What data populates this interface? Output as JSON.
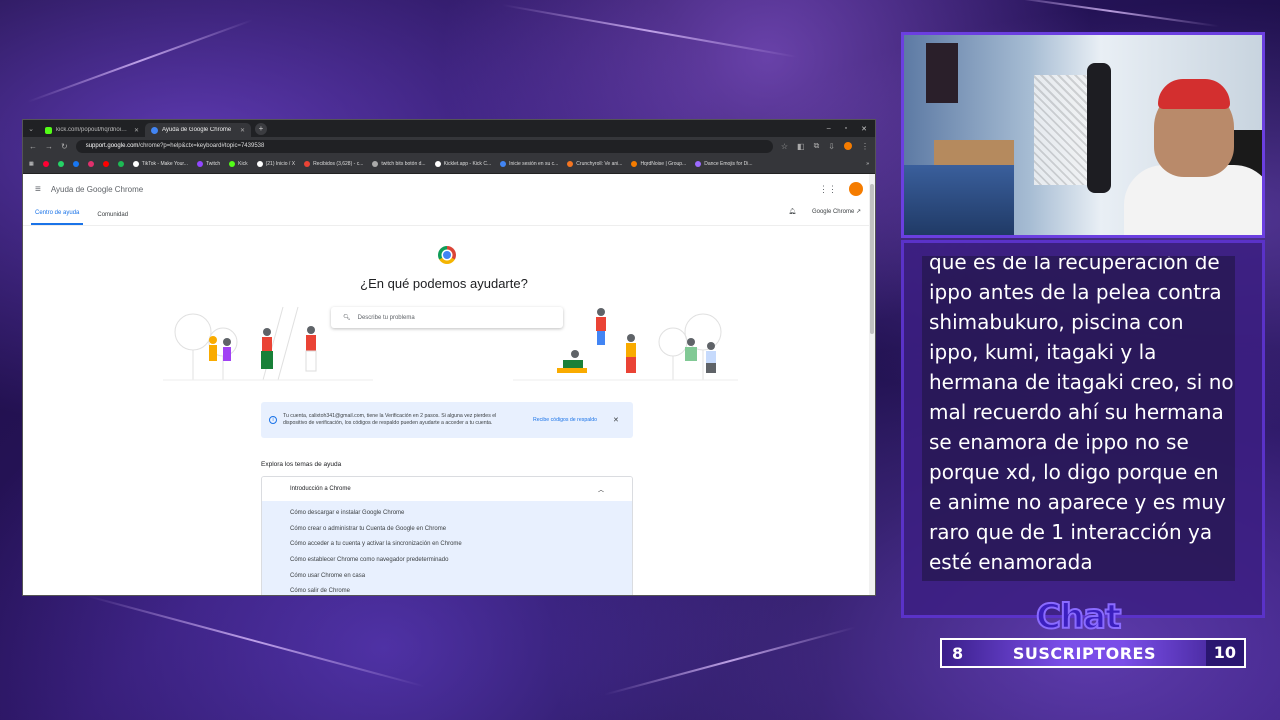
{
  "browser": {
    "tabs": [
      {
        "label": "kick.com/popout/hqrdnoise/ch",
        "favicon_color": "#53fc18",
        "active": false
      },
      {
        "label": "Ayuda de Google Chrome",
        "favicon_color": "#4285f4",
        "active": true
      }
    ],
    "url_host": "support.google.com",
    "url_path": "/chrome?p=help&ctx=keyboard#topic=7439538",
    "bookmarks": [
      {
        "label": "TikTok - Make Your...",
        "color": "#ffffff"
      },
      {
        "label": "Twitch",
        "color": "#9146ff"
      },
      {
        "label": "Kick",
        "color": "#53fc18"
      },
      {
        "label": "(21) Inicio / X",
        "color": "#ffffff"
      },
      {
        "label": "Recibidos (3,628) - c...",
        "color": "#ea4335"
      },
      {
        "label": "twitch bits botón d...",
        "color": "#aaaaaa"
      },
      {
        "label": "Kicklet.app - Kick C...",
        "color": "#ffffff"
      },
      {
        "label": "Inicie sesión en su c...",
        "color": "#4285f4"
      },
      {
        "label": "Crunchyroll: Ve ani...",
        "color": "#f47521"
      },
      {
        "label": "HqrdNoise | Group...",
        "color": "#f57c00"
      },
      {
        "label": "Dance Emojis for Di...",
        "color": "#9c6bff"
      }
    ]
  },
  "page": {
    "header_title": "Ayuda de Google Chrome",
    "tabs": [
      "Centro de ayuda",
      "Comunidad"
    ],
    "product_link": "Google Chrome",
    "headline": "¿En qué podemos ayudarte?",
    "search_placeholder": "Describe tu problema",
    "notice_text": "Tu cuenta, calixtoh341@gmail.com, tiene la Verificación en 2 pasos. Si alguna vez pierdes el dispositivo de verificación, los códigos de respaldo pueden ayudarte a acceder a tu cuenta.",
    "notice_link": "Recibe códigos de respaldo",
    "explore_title": "Explora los temas de ayuda",
    "accordion_title": "Introducción a Chrome",
    "accordion_items": [
      "Cómo descargar e instalar Google Chrome",
      "Cómo crear o administrar tu Cuenta de Google en Chrome",
      "Cómo acceder a tu cuenta y activar la sincronización en Chrome",
      "Cómo establecer Chrome como navegador predeterminado",
      "Cómo usar Chrome en casa",
      "Cómo salir de Chrome"
    ]
  },
  "overlay": {
    "chat_message": "que es de la recuperación de ippo antes de la pelea contra shimabukuro, piscina con ippo, kumi, itagaki y la hermana de itagaki creo, si no mal recuerdo ahí su hermana se enamora de ippo no se porque xd, lo digo porque en e anime no aparece y es muy raro que de 1 interacción ya esté enamorada",
    "chat_title": "Chat",
    "subs_current": "8",
    "subs_label": "SUSCRIPTORES",
    "subs_goal": "10"
  }
}
